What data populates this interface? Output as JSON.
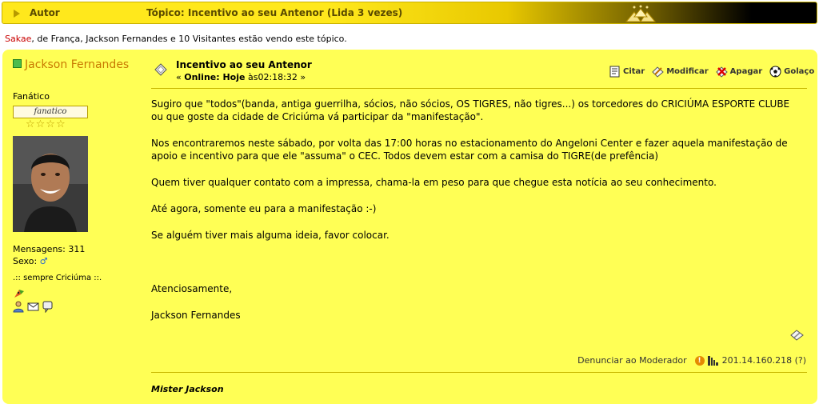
{
  "header": {
    "autor_label": "Autor",
    "topic_label": "Tópico: Incentivo ao seu Antenor  (Lida 3 vezes)"
  },
  "viewers": {
    "highlight_name": "Sakae",
    "rest_text": ", de França, Jackson Fernandes e 10 Visitantes estão vendo este tópico."
  },
  "author": {
    "name": "Jackson Fernandes",
    "rank": "Fanático",
    "rank_badge": "fanatico",
    "stars": "☆☆☆☆",
    "messages": "Mensagens: 311",
    "sexo_label": "Sexo:",
    "sexo_symbol": "♂",
    "personal_text": ".:: sempre Criciúma ::."
  },
  "post": {
    "title": "Incentivo ao seu Antenor",
    "date_prefix": "« ",
    "date_bold": "Online: Hoje",
    "date_rest": " às02:18:32 »",
    "paragraphs": [
      "Sugiro que \"todos\"(banda, antiga guerrilha, sócios, não sócios, OS TIGRES, não tigres...) os torcedores do CRICIÚMA ESPORTE CLUBE ou que goste da cidade de Criciúma vá participar da \"manifestação\".",
      "Nos encontraremos neste sábado, por volta das 17:00 horas no estacionamento do Angeloni Center e fazer aquela manifestação de apoio e incentivo para que ele \"assuma\" o CEC. Todos devem estar com a camisa do TIGRE(de prefência)",
      "Quem tiver qualquer contato com a impressa, chama-la em peso para que chegue esta notícia ao seu conhecimento.",
      "Até agora, somente eu para a manifestação :-)",
      "Se alguém tiver mais alguma ideia, favor colocar."
    ],
    "closing": "Atenciosamente,",
    "closing_name": "Jackson Fernandes",
    "report_link": "Denunciar ao Moderador",
    "ip": "201.14.160.218 (?)",
    "signature": "Mister Jackson"
  },
  "actions": {
    "quote": "Citar",
    "modify": "Modificar",
    "delete": "Apagar",
    "goal": "Golaço"
  }
}
